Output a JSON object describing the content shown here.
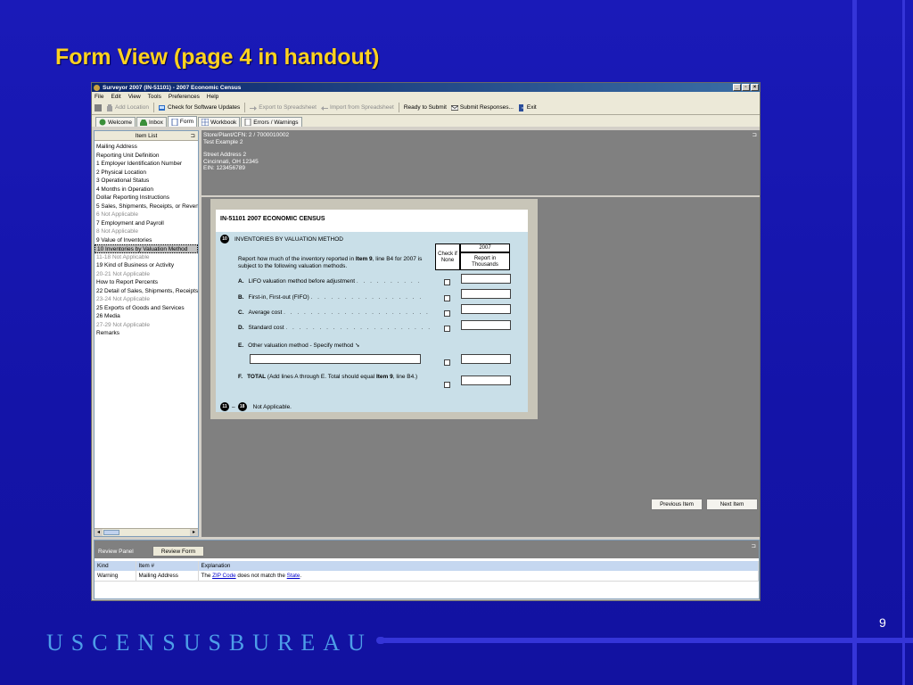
{
  "slide": {
    "title": "Form View (page 4 in handout)",
    "bureau": "USCENSUSBUREAU",
    "page_number": "9"
  },
  "window": {
    "title": "Surveyor 2007 (IN-51101) - 2007 Economic Census",
    "controls": [
      "_",
      "▫",
      "×"
    ]
  },
  "menu": [
    "File",
    "Edit",
    "View",
    "Tools",
    "Preferences",
    "Help"
  ],
  "toolbar": {
    "add_location": "Add Location",
    "check_updates": "Check for Software Updates",
    "export": "Export to Spreadsheet",
    "import": "Import from Spreadsheet",
    "ready": "Ready to Submit",
    "submit": "Submit Responses...",
    "exit": "Exit"
  },
  "tabs": [
    "Welcome",
    "Inbox",
    "Form",
    "Workbook",
    "Errors / Warnings"
  ],
  "item_list": {
    "header": "Item List",
    "items": [
      {
        "label": "Mailing Address",
        "state": "normal"
      },
      {
        "label": "Reporting Unit Definition",
        "state": "normal"
      },
      {
        "label": "1 Employer Identification Number",
        "state": "normal"
      },
      {
        "label": "2 Physical Location",
        "state": "normal"
      },
      {
        "label": "3 Operational Status",
        "state": "normal"
      },
      {
        "label": "4 Months in Operation",
        "state": "normal"
      },
      {
        "label": "Dollar Reporting Instructions",
        "state": "normal"
      },
      {
        "label": "5 Sales, Shipments, Receipts, or Revenu",
        "state": "normal"
      },
      {
        "label": "6 Not Applicable",
        "state": "na"
      },
      {
        "label": "7 Employment and Payroll",
        "state": "normal"
      },
      {
        "label": "8 Not Applicable",
        "state": "na"
      },
      {
        "label": "9 Value of Inventories",
        "state": "normal"
      },
      {
        "label": "10 Inventories by Valuation Method",
        "state": "sel"
      },
      {
        "label": "11-18 Not Applicable",
        "state": "na"
      },
      {
        "label": "19 Kind of Business or Activity",
        "state": "normal"
      },
      {
        "label": "20-21 Not Applicable",
        "state": "na"
      },
      {
        "label": "How to Report Percents",
        "state": "normal"
      },
      {
        "label": "22 Detail of Sales, Shipments, Receipts,",
        "state": "normal"
      },
      {
        "label": "23-24 Not Applicable",
        "state": "na"
      },
      {
        "label": "25 Exports of Goods and Services",
        "state": "normal"
      },
      {
        "label": "26 Media",
        "state": "normal"
      },
      {
        "label": "27-29 Not Applicable",
        "state": "na"
      },
      {
        "label": "Remarks",
        "state": "normal"
      }
    ]
  },
  "info": {
    "line1": "Store/Plant/CFN: 2 / 7000010002",
    "line2": "Test Example 2",
    "line3": "Street Address 2",
    "line4": "Cincinnati, OH 12345",
    "line5": "EIN: 123456789"
  },
  "form": {
    "title": "IN-51101 2007 ECONOMIC CENSUS",
    "section_num": "10",
    "section_title": "INVENTORIES BY VALUATION METHOD",
    "intro_a": "Report how much of the inventory reported in ",
    "intro_b": "Item 9",
    "intro_c": ", line B4 for 2007 is subject to the following valuation methods.",
    "check_head": "Check if None",
    "year_head": "2007",
    "report_head": "Report in Thousands",
    "lines": [
      {
        "letter": "A.",
        "text": "LIFO valuation method before adjustment",
        "dots": ". . . . . . . . . ."
      },
      {
        "letter": "B.",
        "text": "First-in, First-out (FIFO)",
        "dots": ". . . . . . . . . . . . . . . . ."
      },
      {
        "letter": "C.",
        "text": "Average cost",
        "dots": ". . . . . . . . . . . . . . . . . . . . . ."
      },
      {
        "letter": "D.",
        "text": "Standard cost",
        "dots": ". . . . . . . . . . . . . . . . . . . . . ."
      },
      {
        "letter": "E.",
        "text": "Other valuation method - Specify method",
        "dots": ""
      }
    ],
    "total_letter": "F.",
    "total_bold": "TOTAL",
    "total_a": " (Add lines A through E. Total should equal ",
    "total_b": "Item 9",
    "total_c": ", line B4.)",
    "na_from": "11",
    "na_to": "18",
    "na_text": "Not Applicable."
  },
  "nav": {
    "prev": "Previous Item",
    "next": "Next Item"
  },
  "review": {
    "label": "Review Panel",
    "button": "Review Form",
    "columns": [
      "Kind",
      "Item #",
      "Explanation"
    ],
    "row": {
      "kind": "Warning",
      "item": "Mailing Address",
      "exp_a": "The ",
      "exp_link1": "ZIP Code",
      "exp_b": " does not match the ",
      "exp_link2": "State",
      "exp_c": "."
    }
  }
}
